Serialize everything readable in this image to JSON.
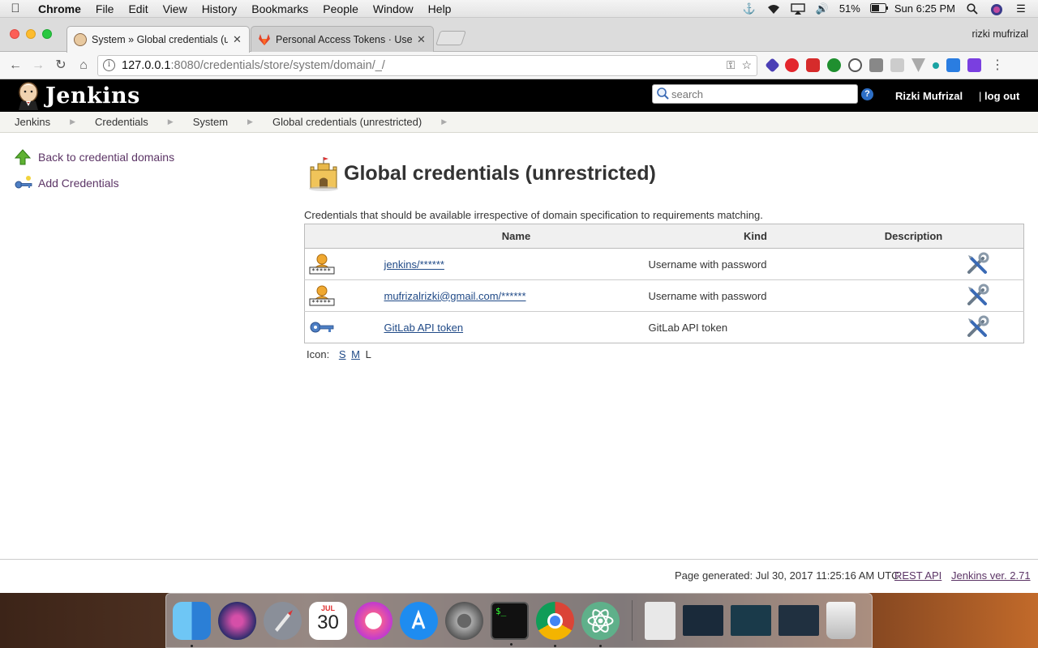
{
  "menubar": {
    "app_name": "Chrome",
    "menus": [
      "File",
      "Edit",
      "View",
      "History",
      "Bookmarks",
      "People",
      "Window",
      "Help"
    ],
    "battery": "51%",
    "clock": "Sun 6:25 PM"
  },
  "browser": {
    "tabs": [
      {
        "title": "System » Global credentials (u",
        "active": true,
        "icon": "jenkins-butler-icon"
      },
      {
        "title": "Personal Access Tokens · User",
        "active": false,
        "icon": "gitlab-icon"
      }
    ],
    "profile_name": "rizki mufrizal",
    "url_host": "127.0.0.1",
    "url_path": ":8080/credentials/store/system/domain/_/"
  },
  "jenkins": {
    "wordmark": "Jenkins",
    "search_placeholder": "search",
    "user": "Rizki Mufrizal",
    "logout": "log out",
    "breadcrumbs": [
      "Jenkins",
      "Credentials",
      "System",
      "Global credentials (unrestricted)"
    ],
    "side_tasks": [
      {
        "label": "Back to credential domains",
        "icon": "up-arrow-icon"
      },
      {
        "label": "Add Credentials",
        "icon": "key-icon"
      }
    ],
    "page_title": "Global credentials (unrestricted)",
    "page_description": "Credentials that should be available irrespective of domain specification to requirements matching.",
    "table": {
      "headers": [
        "Name",
        "Kind",
        "Description"
      ],
      "rows": [
        {
          "name": "jenkins/******",
          "kind": "Username with password",
          "description": "",
          "icon": "user-password-icon"
        },
        {
          "name": "mufrizalrizki@gmail.com/******",
          "kind": "Username with password",
          "description": "",
          "icon": "user-password-icon"
        },
        {
          "name": "GitLab API token",
          "kind": "GitLab API token",
          "description": "",
          "icon": "key-icon"
        }
      ]
    },
    "icon_size": {
      "label": "Icon:",
      "options": [
        "S",
        "M",
        "L"
      ],
      "current": "L"
    },
    "footer": {
      "generated": "Page generated: Jul 30, 2017 11:25:16 AM UTC",
      "rest_api": "REST API",
      "version": "Jenkins ver. 2.71"
    }
  },
  "dock": {
    "calendar_month": "JUL",
    "calendar_day": "30"
  },
  "colors": {
    "jenkins_header": "#000000",
    "link": "#204a87",
    "task_link": "#5c3566"
  }
}
